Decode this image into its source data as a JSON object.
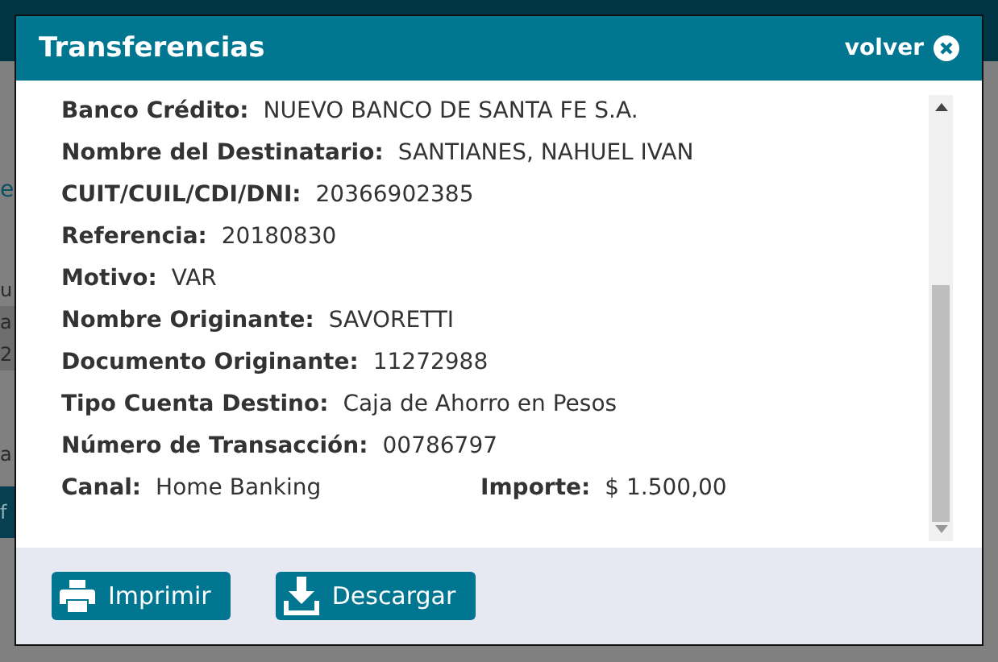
{
  "background_fragments": [
    {
      "text": "e",
      "kind": "heading"
    },
    {
      "text": "u",
      "kind": "plain"
    },
    {
      "text": "a",
      "kind": "shaded"
    },
    {
      "text": "2",
      "kind": "shaded"
    },
    {
      "text": "a",
      "kind": "plain"
    },
    {
      "text": "f",
      "kind": "bar"
    }
  ],
  "dialog": {
    "title": "Transferencias",
    "close_label": "volver"
  },
  "rows": [
    {
      "fields": [
        {
          "label": "Banco Crédito:",
          "value": "NUEVO BANCO DE SANTA FE S.A."
        }
      ]
    },
    {
      "fields": [
        {
          "label": "Nombre del Destinatario:",
          "value": "SANTIANES, NAHUEL IVAN"
        }
      ]
    },
    {
      "fields": [
        {
          "label": "CUIT/CUIL/CDI/DNI:",
          "value": "20366902385"
        }
      ]
    },
    {
      "fields": [
        {
          "label": "Referencia:",
          "value": "20180830"
        }
      ]
    },
    {
      "fields": [
        {
          "label": "Motivo:",
          "value": "VAR"
        }
      ]
    },
    {
      "fields": [
        {
          "label": "Nombre Originante:",
          "value": "SAVORETTI"
        }
      ]
    },
    {
      "fields": [
        {
          "label": "Documento Originante:",
          "value": "11272988"
        }
      ]
    },
    {
      "fields": [
        {
          "label": "Tipo Cuenta Destino:",
          "value": "Caja de Ahorro en Pesos"
        }
      ]
    },
    {
      "fields": [
        {
          "label": "Número de Transacción:",
          "value": "00786797"
        }
      ]
    },
    {
      "fields": [
        {
          "label": "Canal:",
          "value": "Home Banking"
        },
        {
          "label": "Importe:",
          "value": "$ 1.500,00"
        }
      ]
    }
  ],
  "buttons": [
    {
      "label": "Imprimir",
      "kind": "print"
    },
    {
      "label": "Descargar",
      "kind": "download"
    }
  ]
}
